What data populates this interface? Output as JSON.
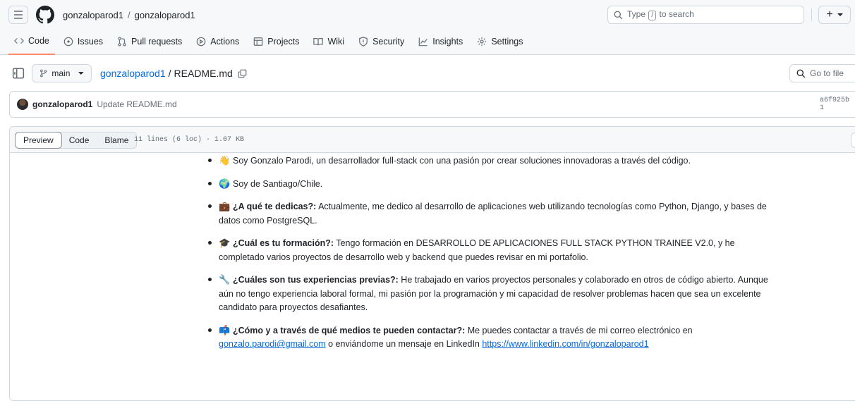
{
  "header": {
    "owner": "gonzaloparod1",
    "separator": "/",
    "repo": "gonzaloparod1",
    "search_text_before": "Type",
    "search_key": "/",
    "search_text_after": "to search",
    "plus_label": "+"
  },
  "tabs": [
    {
      "label": "Code",
      "icon": "code-icon",
      "active": true
    },
    {
      "label": "Issues",
      "icon": "issue-icon"
    },
    {
      "label": "Pull requests",
      "icon": "pull-request-icon"
    },
    {
      "label": "Actions",
      "icon": "play-icon"
    },
    {
      "label": "Projects",
      "icon": "table-icon"
    },
    {
      "label": "Wiki",
      "icon": "book-icon"
    },
    {
      "label": "Security",
      "icon": "shield-icon"
    },
    {
      "label": "Insights",
      "icon": "graph-icon"
    },
    {
      "label": "Settings",
      "icon": "gear-icon"
    }
  ],
  "file": {
    "branch": "main",
    "repo_link": "gonzaloparod1",
    "separator": "/",
    "filename": "README.md",
    "go_to_file": "Go to file"
  },
  "commit": {
    "user": "gonzaloparod1",
    "message": "Update README.md",
    "hash": "a6f925b · 1"
  },
  "viewer": {
    "modes": [
      "Preview",
      "Code",
      "Blame"
    ],
    "active_mode": "Preview",
    "meta": "11 lines (6 loc) · 1.07 KB"
  },
  "readme": {
    "item1": {
      "emoji": "👋",
      "text": "Soy Gonzalo Parodi, un desarrollador full-stack con una pasión por crear soluciones innovadoras a través del código."
    },
    "item2": {
      "emoji": "🌍",
      "text": "Soy de Santiago/Chile."
    },
    "item3": {
      "emoji": "💼",
      "bold": "¿A qué te dedicas?:",
      "text": " Actualmente, me dedico al desarrollo de aplicaciones web utilizando tecnologías como Python, Django, y bases de datos como PostgreSQL."
    },
    "item4": {
      "emoji": "🎓",
      "bold": "¿Cuál es tu formación?:",
      "text": " Tengo formación en DESARROLLO DE APLICACIONES FULL STACK PYTHON TRAINEE V2.0, y he completado varios proyectos de desarrollo web y backend que puedes revisar en mi portafolio."
    },
    "item5": {
      "emoji": "🔧",
      "bold": "¿Cuáles son tus experiencias previas?:",
      "text": " He trabajado en varios proyectos personales y colaborado en otros de código abierto. Aunque aún no tengo experiencia laboral formal, mi pasión por la programación y mi capacidad de resolver problemas hacen que sea un excelente candidato para proyectos desafiantes."
    },
    "item6": {
      "emoji": "📫",
      "bold": "¿Cómo y a través de qué medios te pueden contactar?:",
      "text": " Me puedes contactar a través de mi correo electrónico en ",
      "email": "gonzalo.parodi@gmail.com",
      "middle": " o enviándome un mensaje en LinkedIn ",
      "linkedin": "https://www.linkedin.com/in/gonzaloparod1"
    }
  }
}
